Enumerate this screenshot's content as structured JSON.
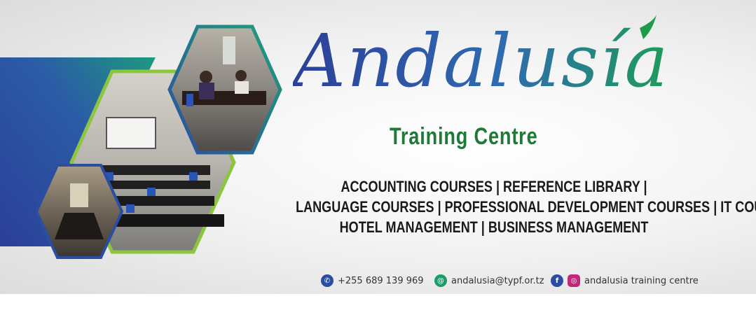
{
  "brand": {
    "name": "Andalusía",
    "subtitle": "Training Centre"
  },
  "courses": {
    "line1": "ACCOUNTING COURSES |  REFERENCE LIBRARY |",
    "line2": "LANGUAGE COURSES | PROFESSIONAL DEVELOPMENT COURSES   | IT COURSES |",
    "line3": "HOTEL MANAGEMENT | BUSINESS MANAGEMENT"
  },
  "contacts": {
    "phone": "+255  689 139 969",
    "email": "andalusia@typf.or.tz",
    "social": "andalusia training centre"
  },
  "icons": [
    "phone-icon",
    "email-icon",
    "facebook-icon",
    "instagram-icon"
  ],
  "colors": {
    "blue": "#2a4ea0",
    "green": "#1f7a38",
    "lime": "#8cc63f",
    "teal": "#1f9a7a"
  }
}
